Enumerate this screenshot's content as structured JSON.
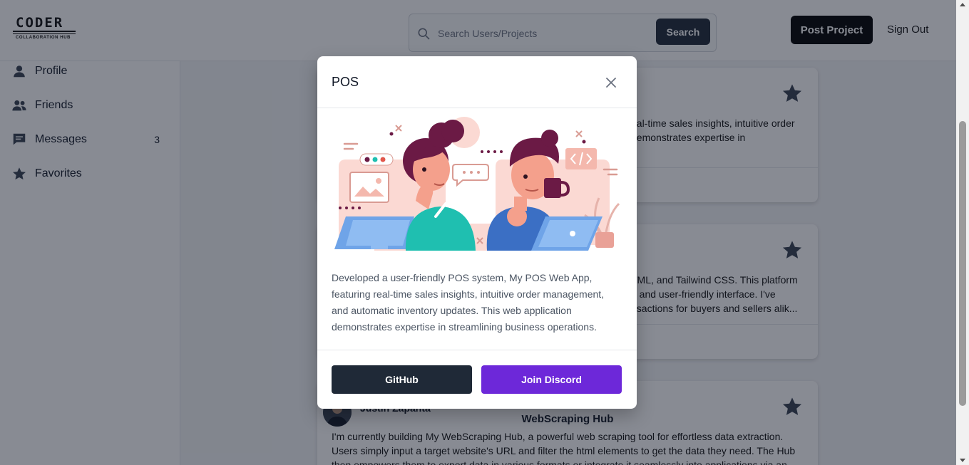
{
  "logo": {
    "main": "CODER",
    "sub": "COLLABORATION HUB"
  },
  "search": {
    "placeholder": "Search Users/Projects",
    "value": "",
    "button_label": "Search"
  },
  "header": {
    "post_project_label": "Post Project",
    "sign_out_label": "Sign Out"
  },
  "sidebar": {
    "items": [
      {
        "label": "Profile",
        "icon": "user-icon"
      },
      {
        "label": "Friends",
        "icon": "users-icon"
      },
      {
        "label": "Messages",
        "icon": "message-icon",
        "badge": "3"
      },
      {
        "label": "Favorites",
        "icon": "star-icon"
      }
    ]
  },
  "feed": {
    "cards": [
      {
        "text_fragment": "eal-time sales insights, intuitive order demonstrates expertise in"
      },
      {
        "text_fragment": "TML, and Tailwind CSS. This platform n and user-friendly interface. I've nsactions for buyers and sellers alik..."
      },
      {
        "author": "Justin Zapanta",
        "title": "WebScraping Hub",
        "description": "I'm currently building My WebScraping Hub, a powerful web scraping tool for effortless data extraction. Users simply input a target website's URL and filter the html elements to get the data they need. The Hub then empowers them to export data in various formats or integrate it seamlessly into applications via an"
      }
    ]
  },
  "modal": {
    "title": "POS",
    "description": "Developed a user-friendly POS system, My POS Web App, featuring real-time sales insights, intuitive order management, and automatic inventory updates. This web application demonstrates expertise in streamlining business operations.",
    "github_label": "GitHub",
    "discord_label": "Join Discord"
  },
  "colors": {
    "primary_dark": "#1f2937",
    "discord_purple": "#6d28d9",
    "overlay": "rgba(17,24,39,0.5)",
    "illustration_pink": "#f9c9c2",
    "illustration_maroon": "#6b1a45",
    "illustration_teal": "#1fbfb0",
    "illustration_blue": "#3b6fc4"
  }
}
